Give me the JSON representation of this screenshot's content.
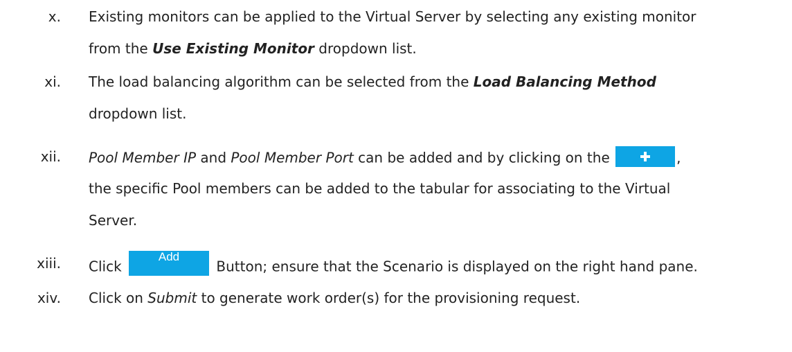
{
  "items": [
    {
      "number": "x.",
      "lines": {
        "l1": "Existing monitors can be applied to the Virtual Server by selecting any existing monitor",
        "l2_a": "from the ",
        "l2_b": "Use Existing Monitor",
        "l2_c": " dropdown list."
      }
    },
    {
      "number": "xi.",
      "lines": {
        "l1_a": "The load balancing algorithm can be selected from the ",
        "l1_b": "Load Balancing Method",
        "l2": "dropdown list."
      }
    },
    {
      "number": "xii.",
      "lines": {
        "l1_a": "Pool Member IP",
        "l1_b": " and ",
        "l1_c": "Pool Member Port",
        "l1_d": " can be added and by clicking on the ",
        "l1_e": ",",
        "l2": "the specific Pool members can be added to the tabular for associating to the Virtual",
        "l3": "Server."
      }
    },
    {
      "number": "xiii.",
      "lines": {
        "l1_a": "Click ",
        "button": "Add",
        "l1_b": " Button; ensure that the Scenario is displayed on the right hand pane."
      }
    },
    {
      "number": "xiv.",
      "lines": {
        "l1_a": "Click on ",
        "l1_b": "Submit",
        "l1_c": " to generate work order(s) for the provisioning request."
      }
    }
  ],
  "colors": {
    "text": "#222222",
    "button": "#0ea5e4",
    "button_text": "#ffffff"
  },
  "icons": {
    "plus_button": "plus-icon"
  }
}
